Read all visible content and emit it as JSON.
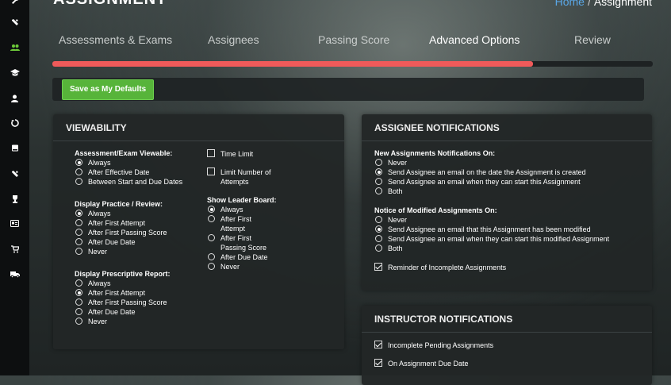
{
  "sidebar": {
    "icons": [
      "wrench-icon",
      "users-icon",
      "graduation-cap-icon",
      "user-icon",
      "history-icon",
      "book-icon",
      "tools-icon",
      "trophy-icon",
      "id-card-icon",
      "cart-icon",
      "ambulance-icon"
    ]
  },
  "header": {
    "title": "ASSIGNMENT",
    "breadcrumb_home": "Home",
    "breadcrumb_sep": "/",
    "breadcrumb_current": "Assignment"
  },
  "tabs": [
    {
      "label": "Assessments & Exams"
    },
    {
      "label": "Assignees"
    },
    {
      "label": "Passing Score"
    },
    {
      "label": "Advanced Options"
    },
    {
      "label": "Review"
    }
  ],
  "progress": {
    "fraction": 0.8
  },
  "toolbar": {
    "save_defaults": "Save as My Defaults"
  },
  "viewability": {
    "title": "VIEWABILITY",
    "exam_viewable": {
      "label": "Assessment/Exam Viewable:",
      "options": [
        "Always",
        "After Effective Date",
        "Between Start and Due Dates"
      ],
      "selected": 0
    },
    "practice_review": {
      "label": "Display Practice / Review:",
      "options": [
        "Always",
        "After First Attempt",
        "After First Passing Score",
        "After Due Date",
        "Never"
      ],
      "selected": 0
    },
    "prescriptive": {
      "label": "Display Prescriptive Report:",
      "options": [
        "Always",
        "After First Attempt",
        "After First Passing Score",
        "After Due Date",
        "Never"
      ],
      "selected": 1
    },
    "time_limit": {
      "label": "Time Limit",
      "checked": false
    },
    "limit_attempts": {
      "label1": "Limit Number of",
      "label2": "Attempts",
      "checked": false
    },
    "leader_board": {
      "label": "Show Leader Board:",
      "options": [
        "Always",
        "After First|Attempt",
        "After First|Passing Score",
        "After Due Date",
        "Never"
      ],
      "selected": 0
    }
  },
  "assignee_notifications": {
    "title": "ASSIGNEE NOTIFICATIONS",
    "new_assign": {
      "label": "New Assignments Notifications On:",
      "options": [
        "Never",
        "Send Assignee an email on the date the Assignment is created",
        "Send Assignee an email when they can start this Assignment",
        "Both"
      ],
      "selected": 1
    },
    "modified": {
      "label": "Notice of Modified Assignments On:",
      "options": [
        "Never",
        "Send Assignee an email that this Assignment has been modified",
        "Send Assignee an email when they can start this modified Assignment",
        "Both"
      ],
      "selected": 1
    },
    "reminder": {
      "label": "Reminder of Incomplete Assignments",
      "checked": true
    }
  },
  "instructor_notifications": {
    "title": "INSTRUCTOR NOTIFICATIONS",
    "incomplete": {
      "label": "Incomplete Pending Assignments",
      "checked": true
    },
    "due_date": {
      "label": "On Assignment Due Date",
      "checked": true
    }
  }
}
